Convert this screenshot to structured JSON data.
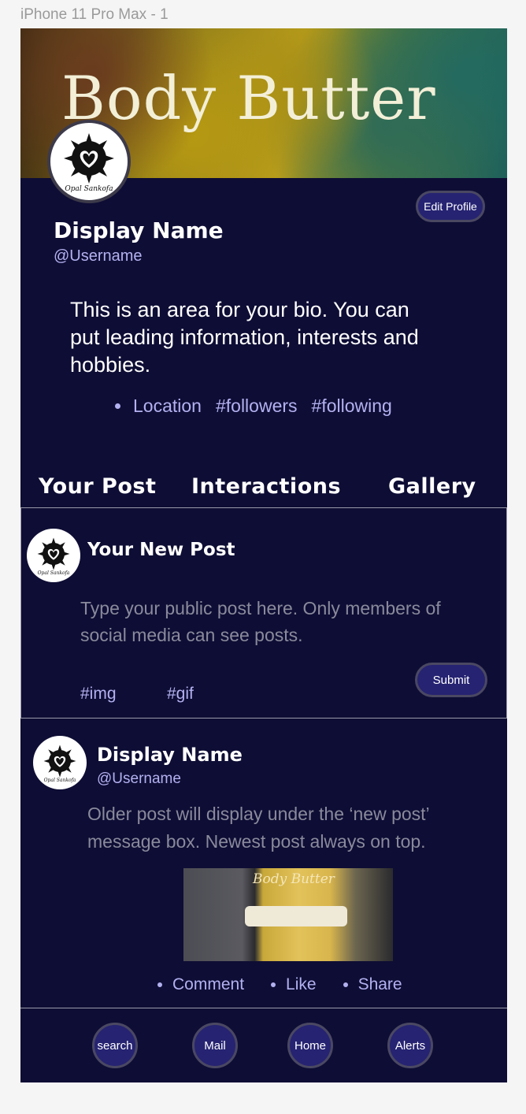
{
  "frame": {
    "label": "iPhone 11 Pro Max - 1"
  },
  "banner": {
    "title": "Body Butter"
  },
  "profile": {
    "avatar_text": "Opal Sankofa",
    "edit_label": "Edit Profile",
    "display_name": "Display Name",
    "username": "@Username",
    "bio": "This is an area for your bio. You can put leading information, interests and hobbies.",
    "stats": [
      "Location",
      "#followers",
      "#following"
    ]
  },
  "tabs": [
    "Your Post",
    "Interactions",
    "Gallery"
  ],
  "new_post": {
    "avatar_text": "Opal Sankofa",
    "title": "Your New Post",
    "placeholder": "Type your public post here. Only members of social media can see posts.",
    "tags": [
      "#img",
      "#gif"
    ],
    "submit_label": "Submit"
  },
  "post": {
    "avatar_text": "Opal Sankofa",
    "display_name": "Display Name",
    "username": "@Username",
    "text": "Older post will display under the ‘new post’ message box. Newest post always on top.",
    "image_label": "Body Butter",
    "actions": [
      "Comment",
      "Like",
      "Share"
    ]
  },
  "bottom_nav": [
    "search",
    "Mail",
    "Home",
    "Alerts"
  ],
  "colors": {
    "background": "#0e0d35",
    "accent_button": "#262372",
    "link_text": "#b3b1f0",
    "placeholder_text": "#8a8a9c"
  },
  "icons": {
    "avatar": "sankofa-heart-icon"
  }
}
